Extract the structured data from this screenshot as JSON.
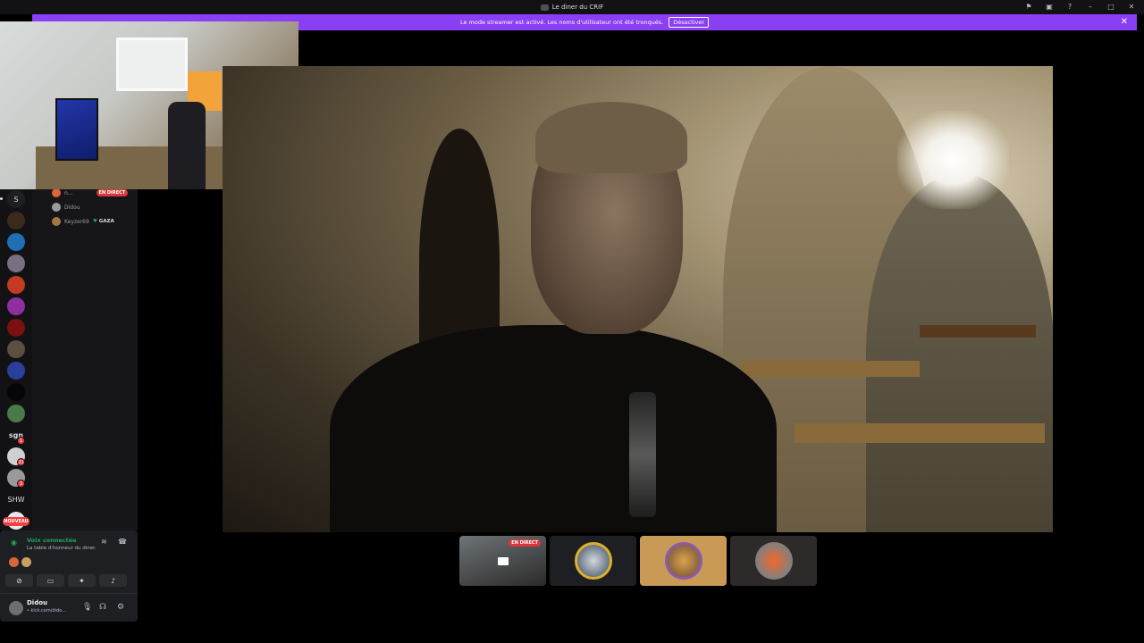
{
  "window": {
    "title": "Le diner du CRIF",
    "controls": [
      "⚑",
      "▣",
      "?",
      "–",
      "□",
      "✕"
    ]
  },
  "banner": {
    "message": "Le mode streamer est activé. Les noms d'utilisateur ont été tronqués.",
    "button_label": "Désactiver",
    "close": "✕"
  },
  "servers": {
    "labels": {
      "s": "S",
      "sgn": "sgn",
      "shw": "SHW"
    },
    "badges": [
      "1",
      "21",
      "3"
    ],
    "nouveau": "NOUVEAU"
  },
  "voice_users": [
    {
      "name": "n...",
      "live": "EN DIRECT"
    },
    {
      "name": "Didou"
    },
    {
      "name": "Keyzer69",
      "tag": "GAZA",
      "heart": "♥"
    }
  ],
  "stream_tiles": [
    {
      "live": "EN DIRECT"
    }
  ],
  "voice_panel": {
    "status": "Voix connectée",
    "channel": "La table d'honneur du diner..."
  },
  "user": {
    "name": "Didou",
    "status": "• kick.com/dido..."
  },
  "colors": {
    "accent_purple": "#8a3ff5",
    "live_red": "#da373c",
    "voice_green": "#23a55a"
  }
}
